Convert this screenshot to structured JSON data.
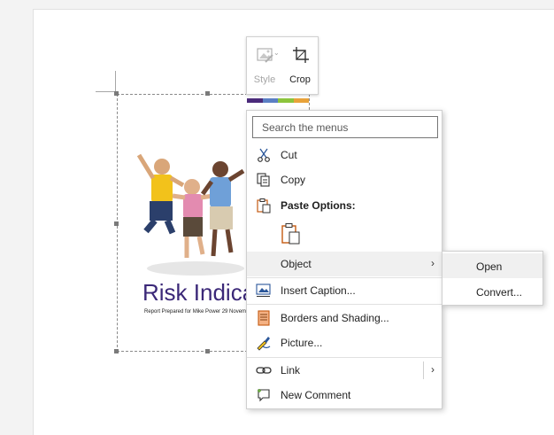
{
  "mini_toolbar": {
    "style_label": "Style",
    "crop_label": "Crop"
  },
  "picture": {
    "title": "Risk Indicat",
    "subtitle": "Report Prepared for Mike Power 29 November",
    "stripe_colors": [
      "#4a2a7a",
      "#5b7fc4",
      "#8cc43c",
      "#e8a23a"
    ]
  },
  "context_menu": {
    "search_placeholder": "Search the menus",
    "items": {
      "cut": "Cut",
      "copy": "Copy",
      "paste_options": "Paste Options:",
      "object": "Object",
      "insert_caption": "Insert Caption...",
      "borders_shading": "Borders and Shading...",
      "picture": "Picture...",
      "link": "Link",
      "new_comment": "New Comment"
    }
  },
  "submenu": {
    "open": "Open",
    "convert": "Convert..."
  },
  "icons": {
    "cut": "scissors-icon",
    "copy": "copy-icon",
    "paste": "clipboard-icon",
    "caption": "insert-caption-icon",
    "borders": "borders-shading-icon",
    "picture": "format-picture-icon",
    "link": "link-icon",
    "comment": "new-comment-icon"
  }
}
